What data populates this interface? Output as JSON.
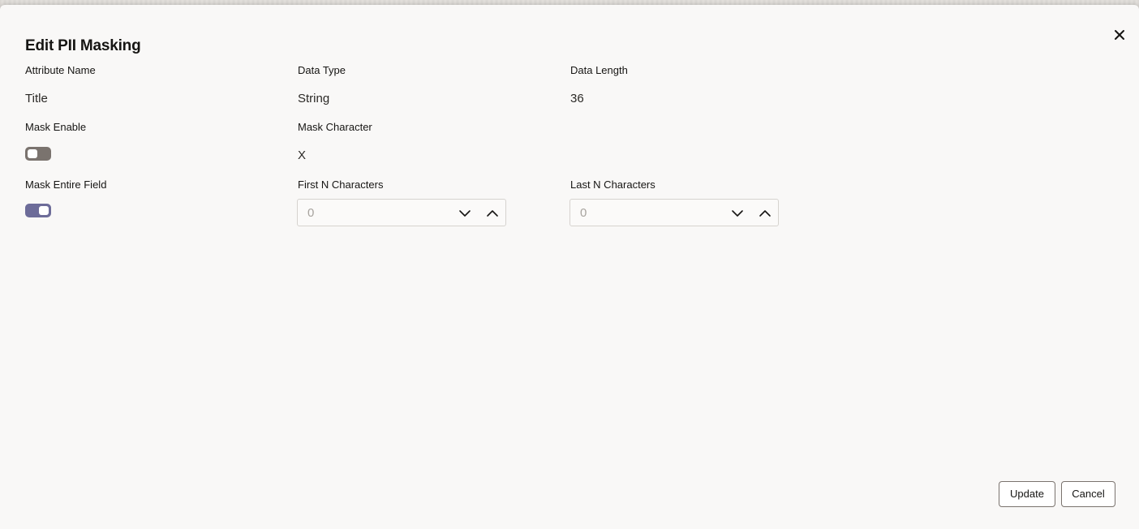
{
  "dialog": {
    "title": "Edit PII Masking",
    "close_icon": "close-icon"
  },
  "fields": {
    "attribute_name": {
      "label": "Attribute Name",
      "value": "Title"
    },
    "data_type": {
      "label": "Data Type",
      "value": "String"
    },
    "data_length": {
      "label": "Data Length",
      "value": "36"
    },
    "mask_enable": {
      "label": "Mask Enable",
      "checked": false
    },
    "mask_character": {
      "label": "Mask Character",
      "value": "X"
    },
    "mask_entire_field": {
      "label": "Mask Entire Field",
      "checked": true
    },
    "first_n_characters": {
      "label": "First N Characters",
      "value": "0",
      "icons": [
        "chevron-down-icon",
        "chevron-up-icon"
      ]
    },
    "last_n_characters": {
      "label": "Last N Characters",
      "value": "0",
      "icons": [
        "chevron-down-icon",
        "chevron-up-icon"
      ]
    }
  },
  "footer": {
    "update_label": "Update",
    "cancel_label": "Cancel"
  },
  "colors": {
    "toggle_on": "#6d6c99",
    "toggle_off": "#7a736e",
    "dialog_bg": "#f9f8f7"
  }
}
